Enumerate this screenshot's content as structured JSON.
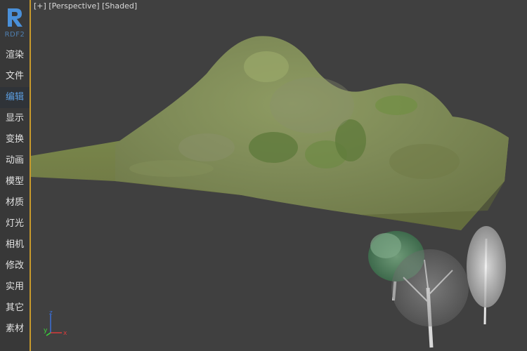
{
  "app": {
    "logo_letter": "R",
    "logo_sub": "RDF2"
  },
  "sidebar": {
    "items": [
      {
        "label": "渲染",
        "active": false
      },
      {
        "label": "文件",
        "active": false
      },
      {
        "label": "编辑",
        "active": true
      },
      {
        "label": "显示",
        "active": false
      },
      {
        "label": "变换",
        "active": false
      },
      {
        "label": "动画",
        "active": false
      },
      {
        "label": "模型",
        "active": false
      },
      {
        "label": "材质",
        "active": false
      },
      {
        "label": "灯光",
        "active": false
      },
      {
        "label": "相机",
        "active": false
      },
      {
        "label": "修改",
        "active": false
      },
      {
        "label": "实用",
        "active": false
      },
      {
        "label": "其它",
        "active": false
      },
      {
        "label": "素材",
        "active": false
      }
    ]
  },
  "viewport": {
    "plus": "[+]",
    "view": "[Perspective]",
    "mode": "[Shaded]",
    "gizmo": {
      "z": "z",
      "y": "y",
      "x": "x"
    }
  },
  "colors": {
    "accent_border": "#c89a2c",
    "active_text": "#5c9ee0",
    "logo_blue": "#4a90d9"
  }
}
